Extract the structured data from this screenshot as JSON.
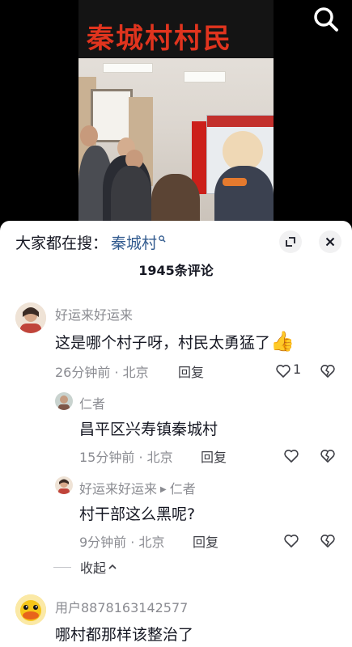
{
  "video": {
    "banner_text": "秦城村村民"
  },
  "search_bar": {
    "prefix": "大家都在搜：",
    "term": "秦城村"
  },
  "comments_header": {
    "count_label": "1945条评论"
  },
  "comments": [
    {
      "username": "好运来好运来",
      "text": "这是哪个村子呀，村民太勇猛了",
      "emoji": "👍",
      "time": "26分钟前",
      "location": "北京",
      "reply_label": "回复",
      "likes": "1",
      "replies": [
        {
          "username": "仁者",
          "text": "昌平区兴寿镇秦城村",
          "time": "15分钟前",
          "location": "北京",
          "reply_label": "回复"
        },
        {
          "username": "好运来好运来",
          "reply_to": "仁者",
          "text": "村干部这么黑呢?",
          "time": "9分钟前",
          "location": "北京",
          "reply_label": "回复"
        }
      ],
      "collapse_label": "收起"
    },
    {
      "username": "用户8878163142577",
      "text": "哪村都那样该整治了"
    }
  ],
  "colors": {
    "link_blue": "#315a8e",
    "meta_gray": "#8a8b91",
    "text_dark": "#161823",
    "banner_red": "#e0341e"
  },
  "icons": [
    "search-icon",
    "expand-icon",
    "close-icon",
    "heart-icon",
    "broken-heart-icon",
    "thumbs-up-emoji",
    "chevron-up-icon",
    "reply-arrow-icon"
  ]
}
